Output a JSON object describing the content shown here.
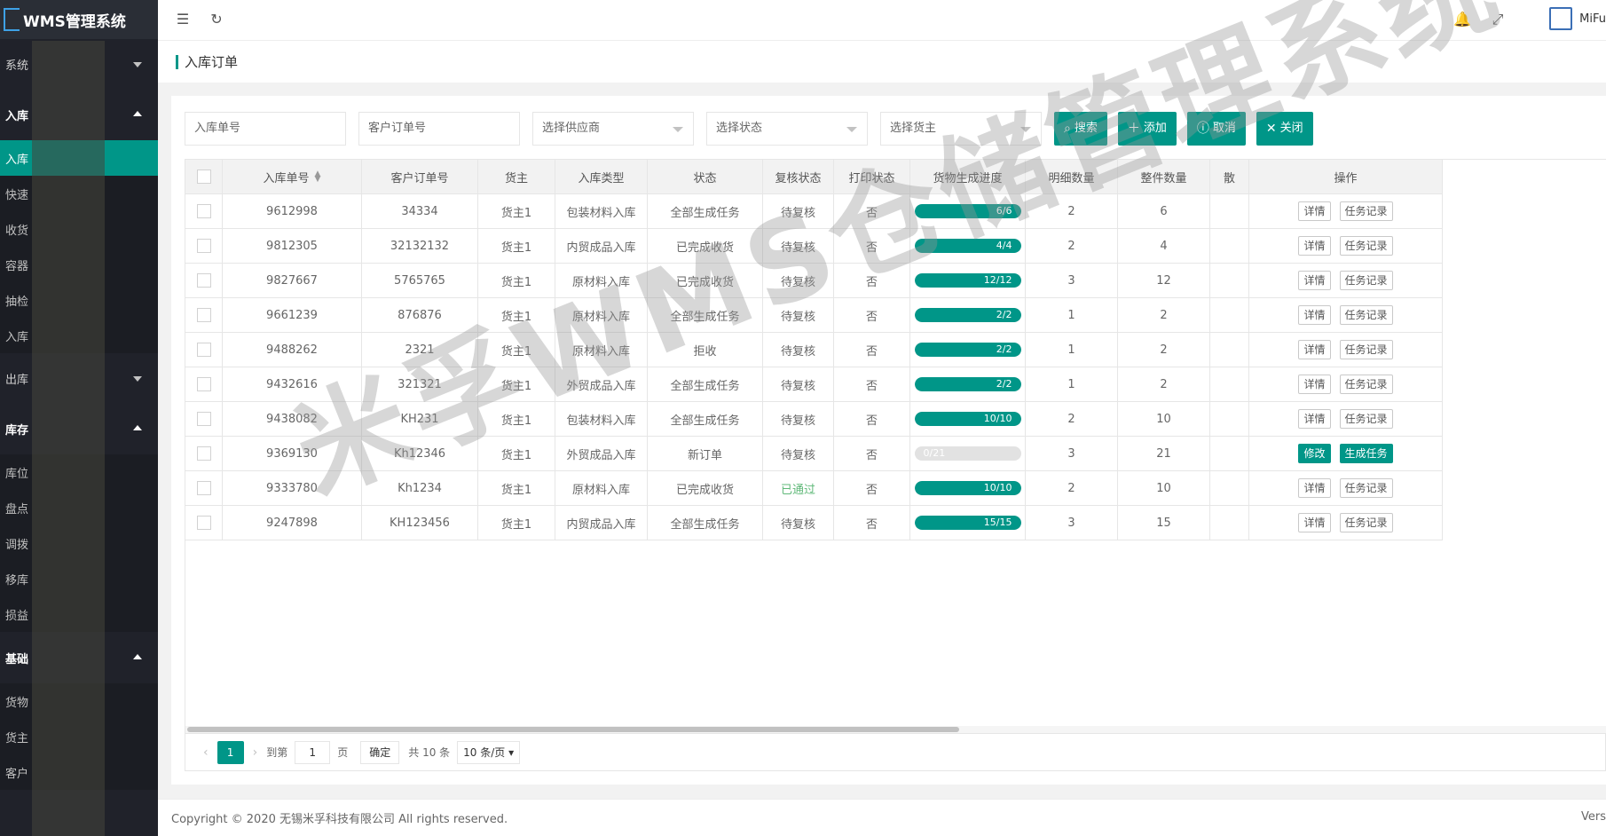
{
  "app": {
    "title": "WMS管理系统",
    "brand_user": "MiFu"
  },
  "sidebar": {
    "items": [
      {
        "label": "系统",
        "kind": "group-collapsed"
      },
      {
        "label": "入库",
        "kind": "group-open"
      },
      {
        "label": "入库",
        "kind": "sub-active"
      },
      {
        "label": "快速",
        "kind": "sub"
      },
      {
        "label": "收货",
        "kind": "sub"
      },
      {
        "label": "容器",
        "kind": "sub"
      },
      {
        "label": "抽检",
        "kind": "sub"
      },
      {
        "label": "入库",
        "kind": "sub"
      },
      {
        "label": "出库",
        "kind": "group-collapsed"
      },
      {
        "label": "库存",
        "kind": "group-open"
      },
      {
        "label": "库位",
        "kind": "sub"
      },
      {
        "label": "盘点",
        "kind": "sub"
      },
      {
        "label": "调拨",
        "kind": "sub"
      },
      {
        "label": "移库",
        "kind": "sub"
      },
      {
        "label": "损益",
        "kind": "sub"
      },
      {
        "label": "基础",
        "kind": "group-open"
      },
      {
        "label": "货物",
        "kind": "sub"
      },
      {
        "label": "货主",
        "kind": "sub"
      },
      {
        "label": "客户",
        "kind": "sub"
      }
    ]
  },
  "breadcrumb": {
    "title": "入库订单"
  },
  "filters": {
    "inbound_no": "入库单号",
    "customer_order_no": "客户订单号",
    "supplier": "选择供应商",
    "status": "选择状态",
    "owner": "选择货主",
    "search": "搜索",
    "add": "添加",
    "cancel": "取消",
    "close": "关闭"
  },
  "table": {
    "headers": [
      "入库单号",
      "客户订单号",
      "货主",
      "入库类型",
      "状态",
      "复核状态",
      "打印状态",
      "货物生成进度",
      "明细数量",
      "整件数量",
      "散",
      "操作"
    ],
    "rows": [
      {
        "no": "9612998",
        "cust": "34334",
        "owner": "货主1",
        "type": "包装材料入库",
        "status": "全部生成任务",
        "review": "待复核",
        "print": "否",
        "progress": "6/6",
        "pct": 1,
        "detail": "2",
        "whole": "6",
        "ops": [
          "详情",
          "任务记录"
        ]
      },
      {
        "no": "9812305",
        "cust": "32132132",
        "owner": "货主1",
        "type": "内贸成品入库",
        "status": "已完成收货",
        "review": "待复核",
        "print": "否",
        "progress": "4/4",
        "pct": 1,
        "detail": "2",
        "whole": "4",
        "ops": [
          "详情",
          "任务记录"
        ]
      },
      {
        "no": "9827667",
        "cust": "5765765",
        "owner": "货主1",
        "type": "原材料入库",
        "status": "已完成收货",
        "review": "待复核",
        "print": "否",
        "progress": "12/12",
        "pct": 1,
        "detail": "3",
        "whole": "12",
        "ops": [
          "详情",
          "任务记录"
        ]
      },
      {
        "no": "9661239",
        "cust": "876876",
        "owner": "货主1",
        "type": "原材料入库",
        "status": "全部生成任务",
        "review": "待复核",
        "print": "否",
        "progress": "2/2",
        "pct": 1,
        "detail": "1",
        "whole": "2",
        "ops": [
          "详情",
          "任务记录"
        ]
      },
      {
        "no": "9488262",
        "cust": "2321",
        "owner": "货主1",
        "type": "原材料入库",
        "status": "拒收",
        "review": "待复核",
        "print": "否",
        "progress": "2/2",
        "pct": 1,
        "detail": "1",
        "whole": "2",
        "ops": [
          "详情",
          "任务记录"
        ]
      },
      {
        "no": "9432616",
        "cust": "321321",
        "owner": "货主1",
        "type": "外贸成品入库",
        "status": "全部生成任务",
        "review": "待复核",
        "print": "否",
        "progress": "2/2",
        "pct": 1,
        "detail": "1",
        "whole": "2",
        "ops": [
          "详情",
          "任务记录"
        ]
      },
      {
        "no": "9438082",
        "cust": "KH231",
        "owner": "货主1",
        "type": "包装材料入库",
        "status": "全部生成任务",
        "review": "待复核",
        "print": "否",
        "progress": "10/10",
        "pct": 1,
        "detail": "2",
        "whole": "10",
        "ops": [
          "详情",
          "任务记录"
        ]
      },
      {
        "no": "9369130",
        "cust": "Kh12346",
        "owner": "货主1",
        "type": "外贸成品入库",
        "status": "新订单",
        "review": "待复核",
        "print": "否",
        "progress": "0/21",
        "pct": 0,
        "detail": "3",
        "whole": "21",
        "ops": [
          "修改",
          "生成任务"
        ]
      },
      {
        "no": "9333780",
        "cust": "Kh1234",
        "owner": "货主1",
        "type": "原材料入库",
        "status": "已完成收货",
        "review": "已通过",
        "print": "否",
        "progress": "10/10",
        "pct": 1,
        "detail": "2",
        "whole": "10",
        "ops": [
          "详情",
          "任务记录"
        ]
      },
      {
        "no": "9247898",
        "cust": "KH123456",
        "owner": "货主1",
        "type": "内贸成品入库",
        "status": "全部生成任务",
        "review": "待复核",
        "print": "否",
        "progress": "15/15",
        "pct": 1,
        "detail": "3",
        "whole": "15",
        "ops": [
          "详情",
          "任务记录"
        ]
      }
    ]
  },
  "pager": {
    "current": "1",
    "goto_label": "到第",
    "goto_value": "1",
    "page_label": "页",
    "confirm": "确定",
    "total": "共 10 条",
    "size": "10 条/页"
  },
  "footer": {
    "copyright": "Copyright © 2020 无锡米孚科技有限公司 All rights reserved.",
    "version": "Vers"
  },
  "watermark": "米孚WMS仓储管理系统",
  "colors": {
    "primary": "#009688",
    "sidebar": "#20222a",
    "passed": "#5fb878"
  }
}
